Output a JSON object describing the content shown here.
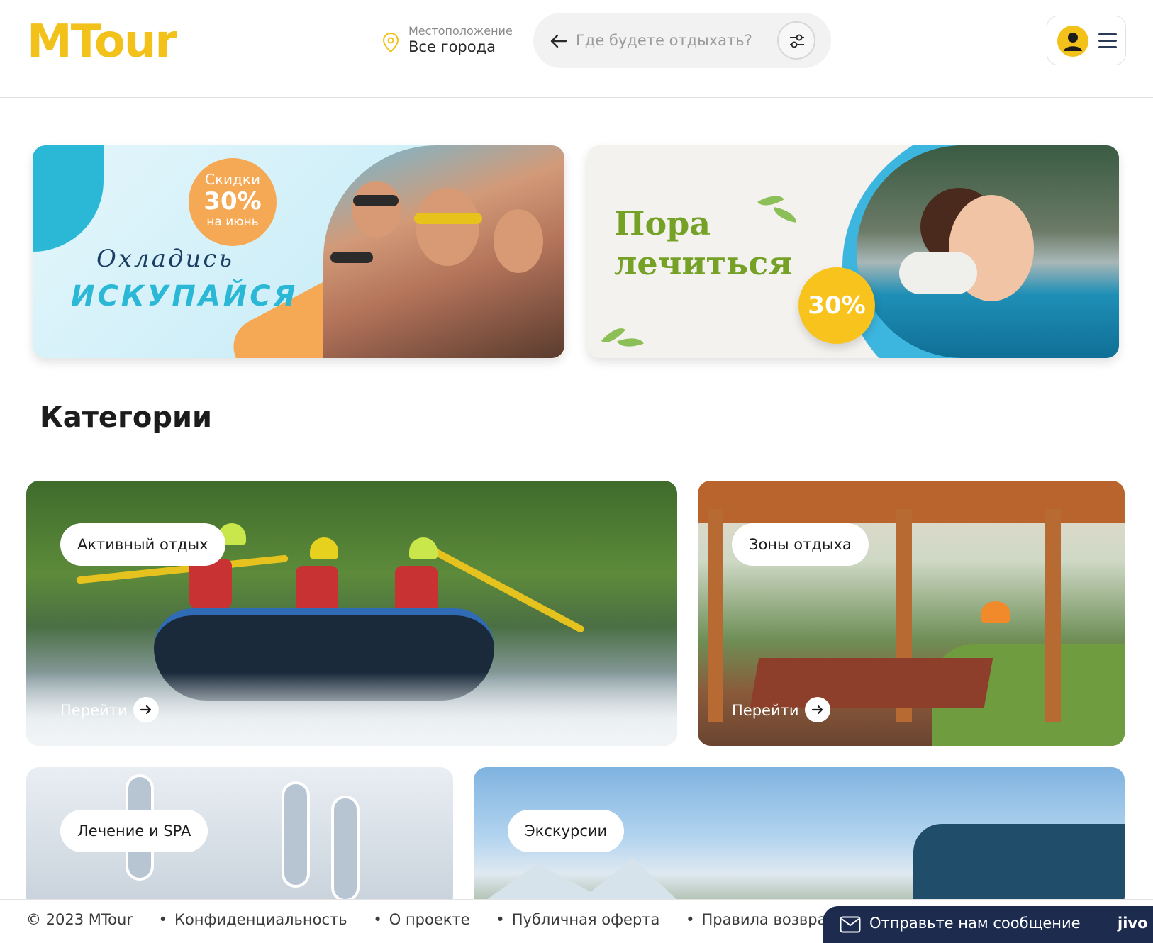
{
  "header": {
    "logo": "MTour",
    "location_label": "Местоположение",
    "location_value": "Все города",
    "search_placeholder": "Где будете отдыхать?"
  },
  "banners": [
    {
      "badge_top": "Скидки",
      "badge_value": "30%",
      "badge_bottom": "на июнь",
      "line1": "Охладись",
      "line2": "ИСКУПАЙСЯ"
    },
    {
      "line1": "Пора",
      "line2": "лечиться",
      "badge_value": "30%"
    }
  ],
  "categories": {
    "title": "Категории",
    "go_label": "Перейти",
    "items": [
      {
        "label": "Активный отдых"
      },
      {
        "label": "Зоны отдыха"
      },
      {
        "label": "Лечение и SPA"
      },
      {
        "label": "Экскурсии"
      }
    ]
  },
  "footer": {
    "copyright": "© 2023 MTour",
    "links": [
      "Конфиденциальность",
      "О проекте",
      "Публичная оферта",
      "Правила возврат"
    ]
  },
  "chat": {
    "label": "Отправьте нам сообщение",
    "brand": "jivo"
  },
  "colors": {
    "brand": "#f2c21b",
    "chat_bg": "#1d2b4f",
    "banner_blue": "#2bb8d6",
    "banner_orange": "#f6a954",
    "banner_green_text": "#74a126"
  },
  "icons": [
    "location-pin-icon",
    "arrow-left-icon",
    "filter-sliders-icon",
    "user-icon",
    "menu-icon",
    "arrow-right-icon",
    "envelope-icon"
  ]
}
